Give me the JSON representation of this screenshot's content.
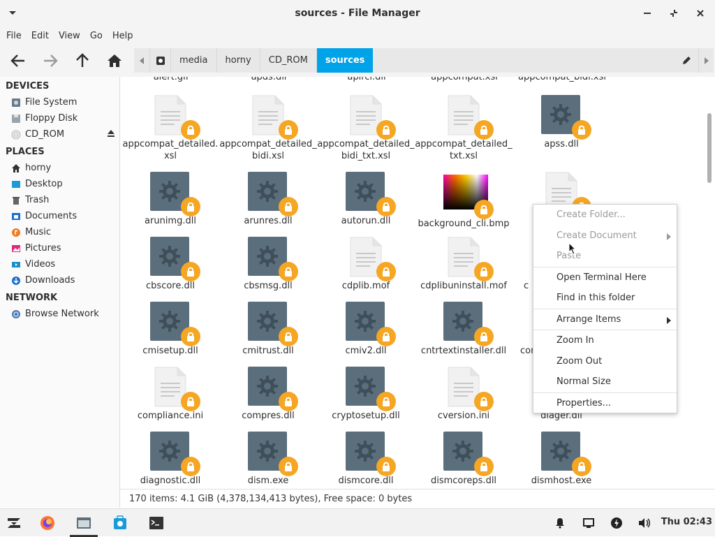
{
  "window": {
    "title": "sources - File Manager"
  },
  "menubar": [
    "File",
    "Edit",
    "View",
    "Go",
    "Help"
  ],
  "pathbar": {
    "crumbs": [
      "media",
      "horny",
      "CD_ROM",
      "sources"
    ]
  },
  "sidebar": {
    "devices_heading": "DEVICES",
    "devices": [
      "File System",
      "Floppy Disk",
      "CD_ROM"
    ],
    "places_heading": "PLACES",
    "places": [
      "horny",
      "Desktop",
      "Trash",
      "Documents",
      "Music",
      "Pictures",
      "Videos",
      "Downloads"
    ],
    "network_heading": "NETWORK",
    "network": [
      "Browse Network"
    ]
  },
  "files": {
    "row0": [
      "alert.gif",
      "apds.dll",
      "apircl.dll",
      "appcompat.xsl",
      "appcompat_bidi.xsl"
    ],
    "row1": [
      "appcompat_detailed.xsl",
      "appcompat_detailed_bidi.xsl",
      "appcompat_detailed_bidi_txt.xsl",
      "appcompat_detailed_txt.xsl",
      "apss.dll"
    ],
    "row2": [
      "arunimg.dll",
      "arunres.dll",
      "autorun.dll",
      "background_cli.bmp",
      ""
    ],
    "row3": [
      "cbscore.dll",
      "cbsmsg.dll",
      "cdplib.mof",
      "cdplibuninstall.mof",
      "c"
    ],
    "row4": [
      "cmisetup.dll",
      "cmitrust.dll",
      "cmiv2.dll",
      "cntrtextinstaller.dll",
      "con"
    ],
    "row5": [
      "compliance.ini",
      "compres.dll",
      "cryptosetup.dll",
      "cversion.ini",
      "diager.dll"
    ],
    "row6": [
      "diagnostic.dll",
      "dism.exe",
      "dismcore.dll",
      "dismcoreps.dll",
      "dismhost.exe"
    ]
  },
  "status": "170 items: 4.1 GiB (4,378,134,413 bytes), Free space: 0 bytes",
  "context_menu": {
    "create_folder": "Create Folder...",
    "create_document": "Create Document",
    "paste": "Paste",
    "open_terminal": "Open Terminal Here",
    "find": "Find in this folder",
    "arrange": "Arrange Items",
    "zoom_in": "Zoom In",
    "zoom_out": "Zoom Out",
    "normal_size": "Normal Size",
    "properties": "Properties..."
  },
  "taskbar": {
    "clock": "Thu 02:43"
  },
  "colors": {
    "accent": "#00a2e8",
    "lock_badge": "#f5a623",
    "gear_tile": "#5a6e7c"
  }
}
